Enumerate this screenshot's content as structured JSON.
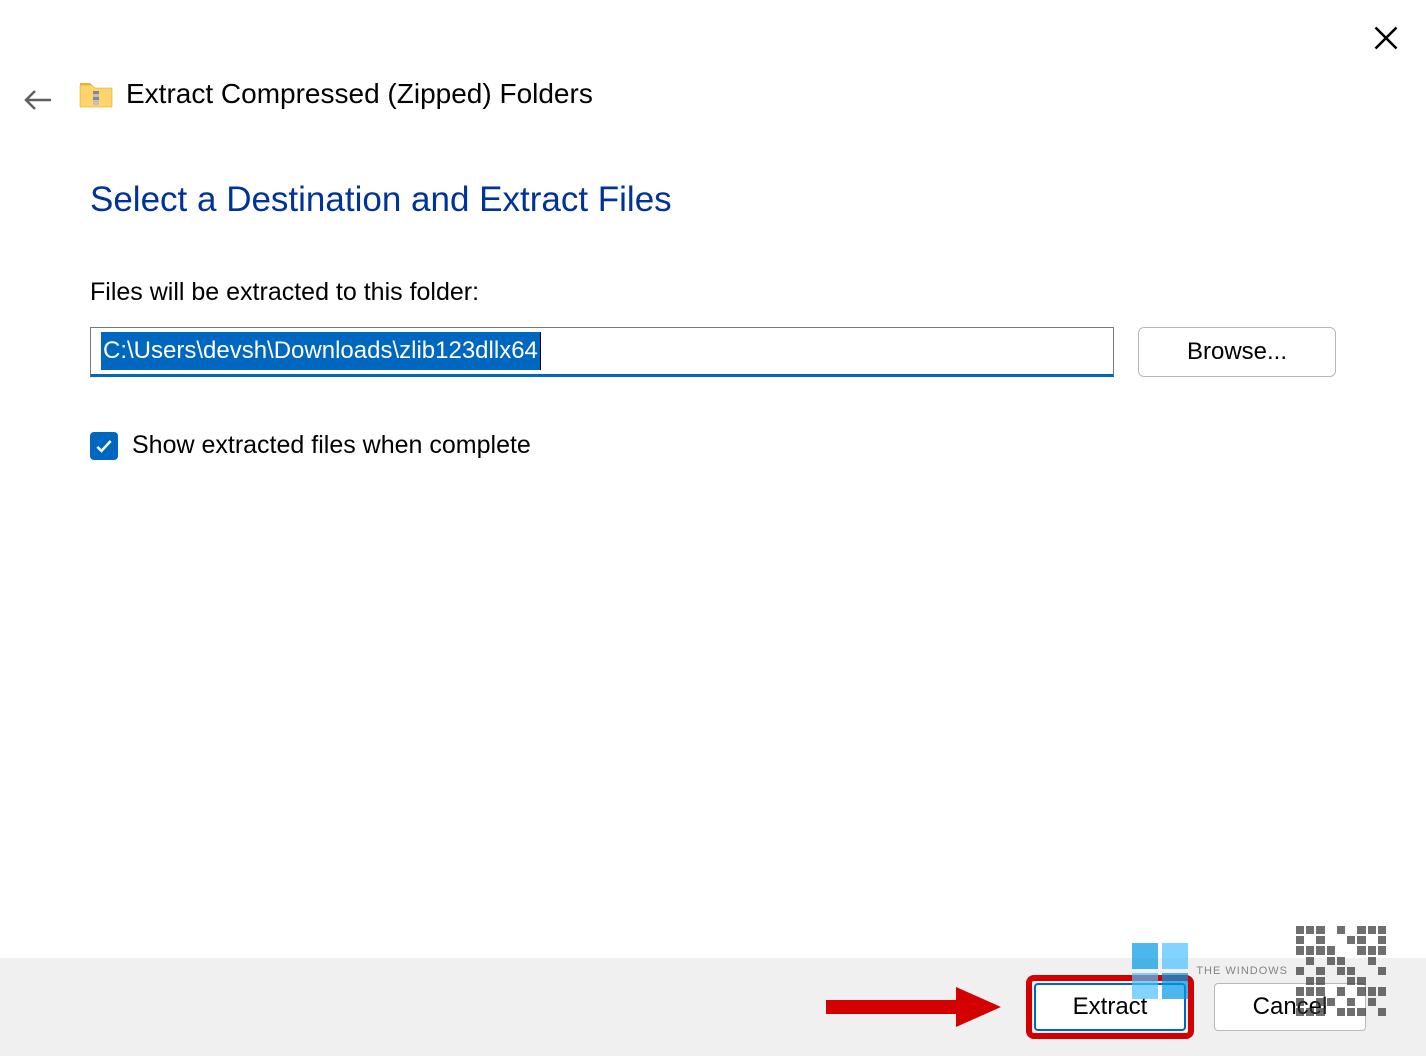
{
  "window": {
    "title": "Extract Compressed (Zipped) Folders"
  },
  "content": {
    "heading": "Select a Destination and Extract Files",
    "path_label": "Files will be extracted to this folder:",
    "path_value": "C:\\Users\\devsh\\Downloads\\zlib123dllx64",
    "browse_label": "Browse...",
    "checkbox_label": "Show extracted files when complete",
    "checkbox_checked": true
  },
  "footer": {
    "extract_label": "Extract",
    "cancel_label": "Cancel"
  },
  "watermark": {
    "text": "THE WINDOWS"
  }
}
